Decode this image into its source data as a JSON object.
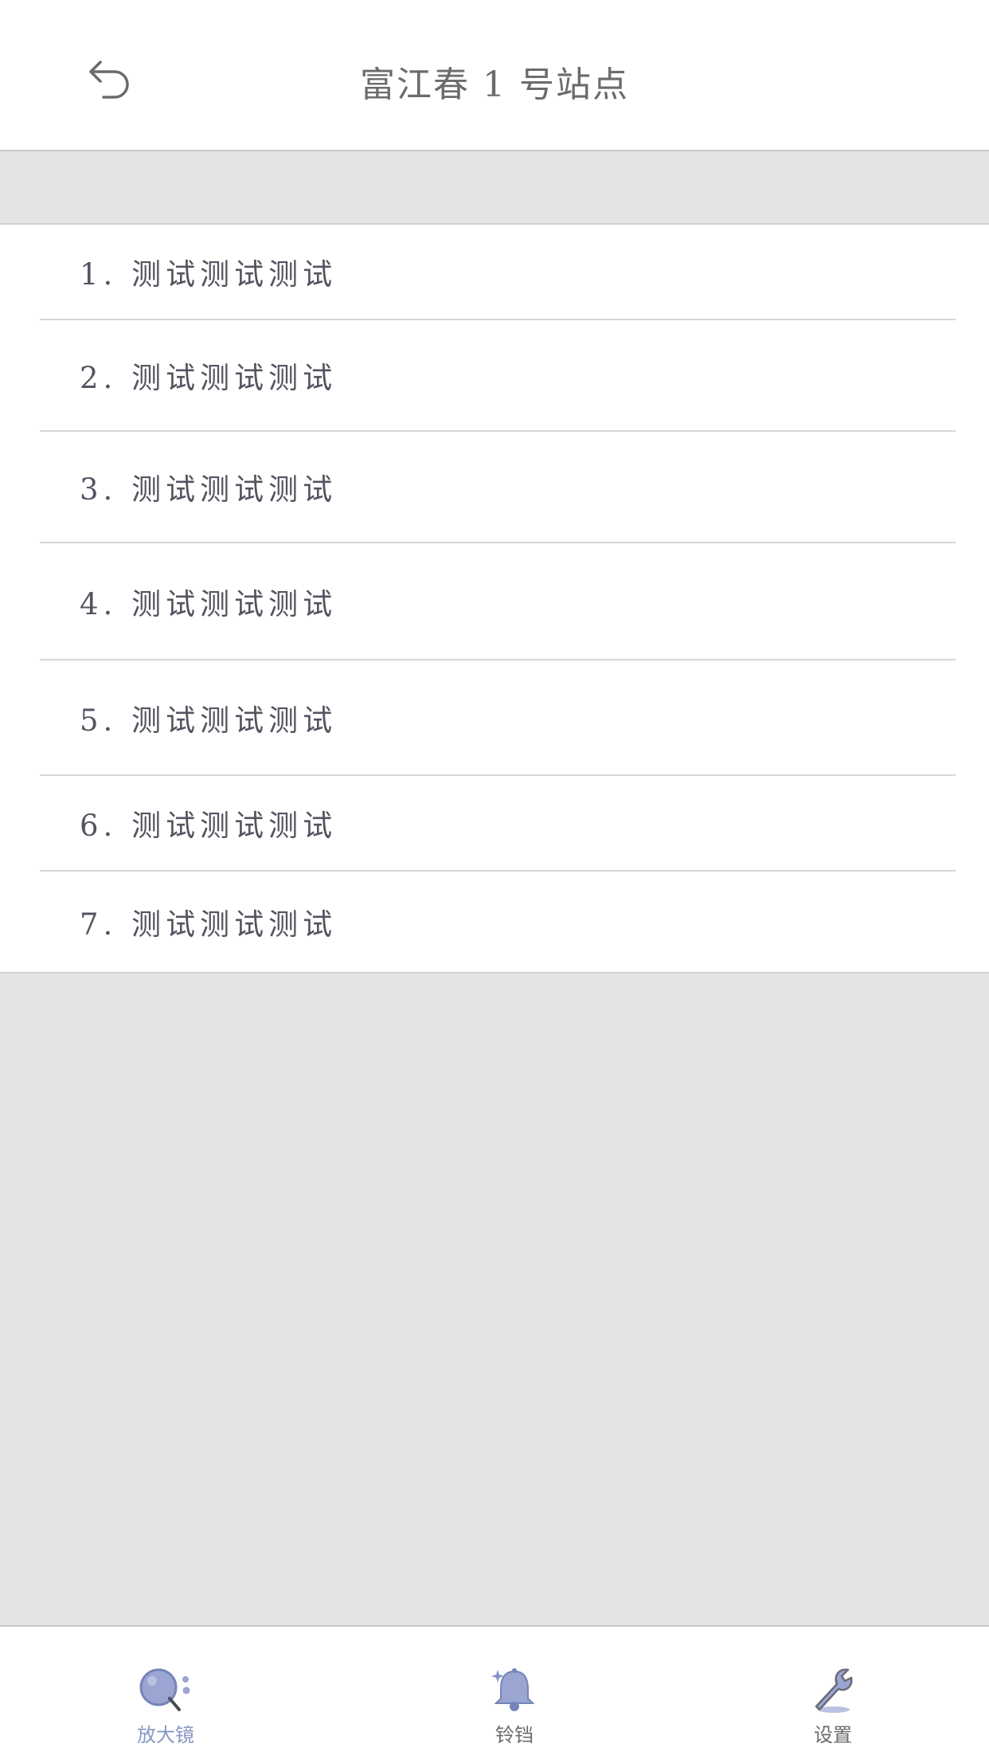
{
  "header": {
    "title": "富江春 1 号站点",
    "back_icon": "undo-icon"
  },
  "list": {
    "items": [
      {
        "label": "1. 测试测试测试"
      },
      {
        "label": "2. 测试测试测试"
      },
      {
        "label": "3. 测试测试测试"
      },
      {
        "label": "4. 测试测试测试"
      },
      {
        "label": "5. 测试测试测试"
      },
      {
        "label": "6. 测试测试测试"
      },
      {
        "label": "7. 测试测试测试"
      }
    ]
  },
  "tabbar": {
    "tabs": [
      {
        "label": "放大镜",
        "icon": "magnifier-icon",
        "active": true
      },
      {
        "label": "铃铛",
        "icon": "bell-icon",
        "active": false
      },
      {
        "label": "设置",
        "icon": "wrench-icon",
        "active": false
      }
    ]
  },
  "colors": {
    "accent": "#8796c4",
    "background": "#e4e4e5",
    "text": "#545460"
  }
}
